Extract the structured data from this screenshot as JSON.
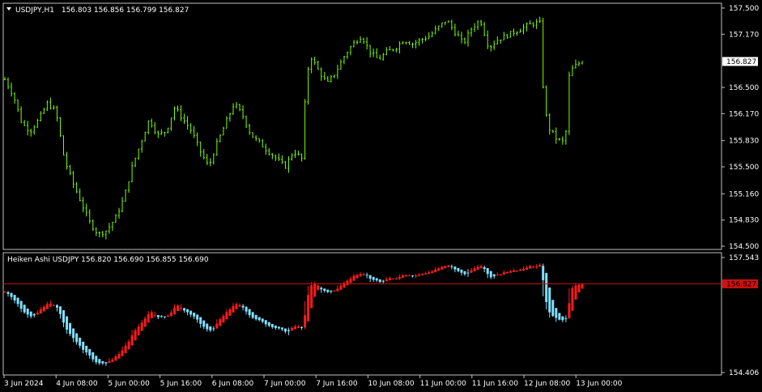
{
  "chart_data": [
    {
      "type": "candlestick",
      "symbol_label": "USDJPY,H1",
      "ohlc_text": "156.803 156.856 156.799 156.827",
      "price_ticks": [
        "157.500",
        "157.170",
        "156.500",
        "156.170",
        "155.830",
        "155.500",
        "155.160",
        "154.830",
        "154.500"
      ],
      "ylim": [
        154.48,
        157.54
      ],
      "current_price": "156.827",
      "current_value": 156.827,
      "candle_color": "#7CFC00",
      "path": [
        [
          0,
          156.6
        ],
        [
          2,
          156.4
        ],
        [
          4,
          156.05
        ],
        [
          6,
          155.95
        ],
        [
          8,
          156.1
        ],
        [
          10,
          156.3
        ],
        [
          12,
          156.2
        ],
        [
          14,
          155.6
        ],
        [
          16,
          155.3
        ],
        [
          18,
          155.05
        ],
        [
          20,
          154.8
        ],
        [
          22,
          154.65
        ],
        [
          24,
          154.7
        ],
        [
          26,
          154.85
        ],
        [
          28,
          155.1
        ],
        [
          30,
          155.5
        ],
        [
          32,
          155.8
        ],
        [
          34,
          156.1
        ],
        [
          36,
          155.9
        ],
        [
          38,
          155.95
        ],
        [
          40,
          156.25
        ],
        [
          42,
          156.1
        ],
        [
          44,
          155.95
        ],
        [
          46,
          155.7
        ],
        [
          48,
          155.5
        ],
        [
          50,
          155.8
        ],
        [
          52,
          156.05
        ],
        [
          54,
          156.3
        ],
        [
          56,
          156.15
        ],
        [
          58,
          155.9
        ],
        [
          60,
          155.8
        ],
        [
          62,
          155.7
        ],
        [
          64,
          155.6
        ],
        [
          66,
          155.5
        ],
        [
          68,
          155.7
        ],
        [
          70,
          155.6
        ],
        [
          71,
          156.6
        ],
        [
          72,
          156.9
        ],
        [
          74,
          156.7
        ],
        [
          76,
          156.55
        ],
        [
          78,
          156.7
        ],
        [
          80,
          156.9
        ],
        [
          82,
          157.05
        ],
        [
          84,
          157.15
        ],
        [
          86,
          156.95
        ],
        [
          88,
          156.85
        ],
        [
          90,
          156.95
        ],
        [
          92,
          157.0
        ],
        [
          94,
          157.1
        ],
        [
          96,
          157.05
        ],
        [
          98,
          157.1
        ],
        [
          100,
          157.15
        ],
        [
          102,
          157.25
        ],
        [
          104,
          157.35
        ],
        [
          106,
          157.2
        ],
        [
          108,
          157.05
        ],
        [
          110,
          157.25
        ],
        [
          112,
          157.35
        ],
        [
          114,
          157.0
        ],
        [
          116,
          157.1
        ],
        [
          118,
          157.15
        ],
        [
          120,
          157.2
        ],
        [
          122,
          157.25
        ],
        [
          124,
          157.3
        ],
        [
          126,
          157.32
        ],
        [
          127,
          156.3
        ],
        [
          128,
          156.0
        ],
        [
          130,
          155.85
        ],
        [
          132,
          155.8
        ],
        [
          133,
          156.7
        ],
        [
          135,
          156.8
        ],
        [
          136,
          156.827
        ]
      ],
      "path_x_range": [
        0,
        136
      ]
    },
    {
      "type": "candlestick",
      "indicator_label": "Heiken Ashi USDJPY 156.820 156.690 156.855 156.690",
      "price_ticks": [
        "157.543",
        "154.406"
      ],
      "ylim": [
        154.406,
        157.543
      ],
      "current_price": "156.827",
      "current_value": 156.827,
      "bull_color": "#ff1a1a",
      "bear_color": "#7fe0ff",
      "x_tick_labels": [
        "3 Jun 2024",
        "4 Jun 08:00",
        "5 Jun 00:00",
        "5 Jun 16:00",
        "6 Jun 08:00",
        "7 Jun 00:00",
        "7 Jun 16:00",
        "10 Jun 08:00",
        "11 Jun 00:00",
        "11 Jun 16:00",
        "12 Jun 08:00",
        "13 Jun 00:00"
      ]
    }
  ]
}
